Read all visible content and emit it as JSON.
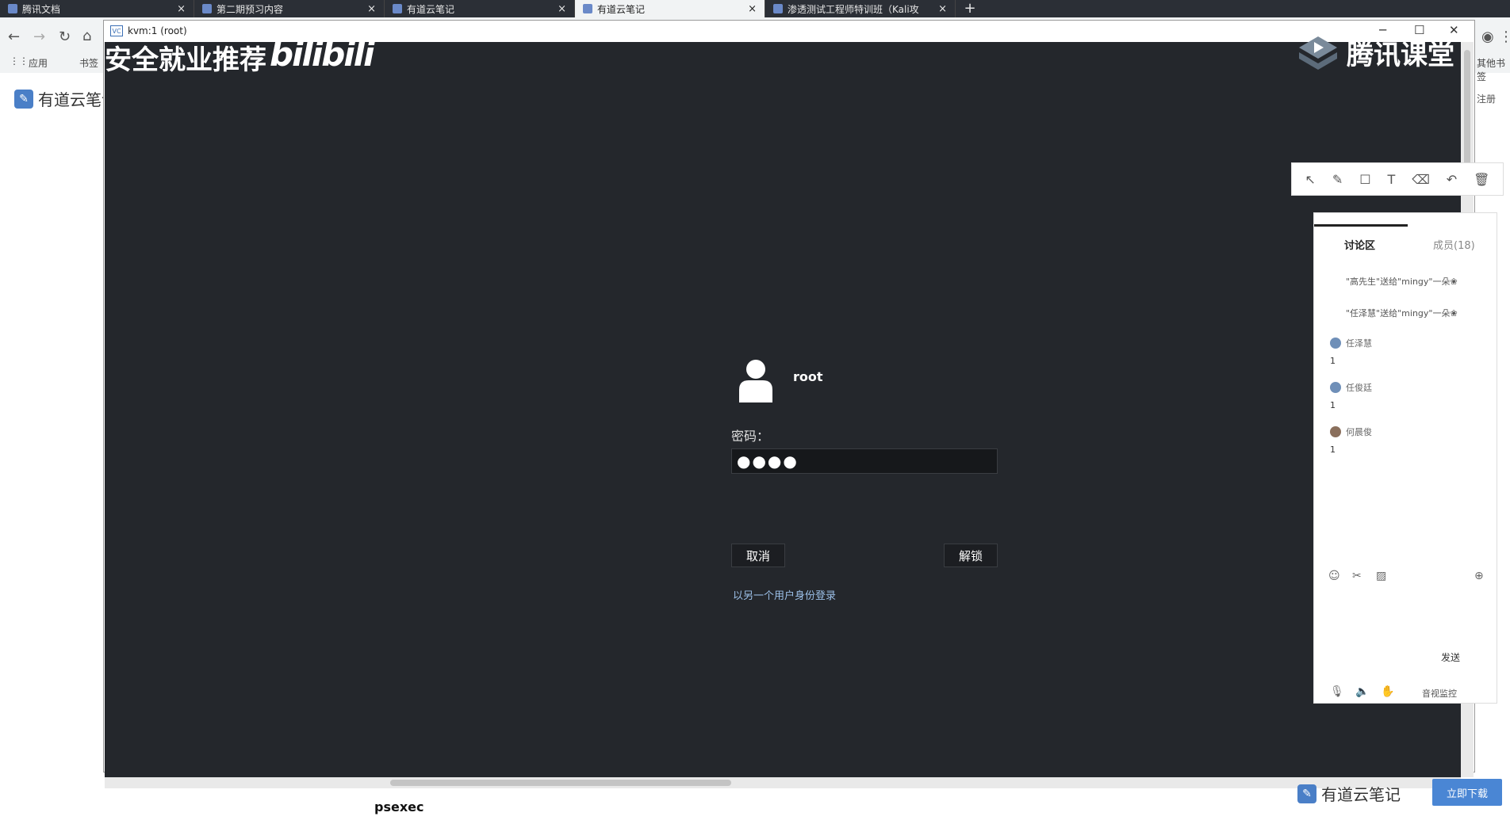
{
  "browser": {
    "tabs": [
      {
        "label": "腾讯文档",
        "close": "×"
      },
      {
        "label": "第二期预习内容",
        "close": "×"
      },
      {
        "label": "有道云笔记",
        "close": "×"
      },
      {
        "label": "有道云笔记",
        "close": "×"
      },
      {
        "label": "渗透测试工程师特训班（Kali攻",
        "close": "×"
      }
    ],
    "new_tab": "+",
    "bookmarks": {
      "apps": "应用",
      "bm1": "书签",
      "other": "其他书签"
    },
    "side_text": "注册"
  },
  "youdao": {
    "logo_text": "有道云笔记",
    "logo_glyph": "✎"
  },
  "vnc": {
    "title": "kvm:1 (root)",
    "icon_text": "VC",
    "min": "─",
    "max": "☐",
    "close": "✕"
  },
  "watermarks": {
    "left": "安全就业推荐",
    "bilibili": "bilibili",
    "right": "腾讯课堂"
  },
  "login": {
    "username": "root",
    "password_label": "密码：",
    "password_value": "●●●●",
    "cancel": "取消",
    "unlock": "解锁",
    "alt_login": "以另一个用户身份登录"
  },
  "drawbar": {
    "select": "↖",
    "pen": "✎",
    "rect": "☐",
    "text": "T",
    "eraser": "⌫",
    "undo": "↶",
    "trash": "🗑"
  },
  "chat": {
    "tab_discuss": "讨论区",
    "tab_members": "成员(18)",
    "system_msgs": [
      "\"高先生\"送给\"mingy\"一朵❀",
      "\"任泽慧\"送给\"mingy\"一朵❀"
    ],
    "messages": [
      {
        "user": "任泽慧",
        "text": "1"
      },
      {
        "user": "任俊廷",
        "text": "1"
      },
      {
        "user": "何晨俊",
        "text": "1"
      }
    ],
    "send": "发送",
    "monitor": "音视监控"
  },
  "bottom": {
    "heading": "psexec",
    "logo_text": "有道云笔记",
    "download": "立即下载"
  }
}
